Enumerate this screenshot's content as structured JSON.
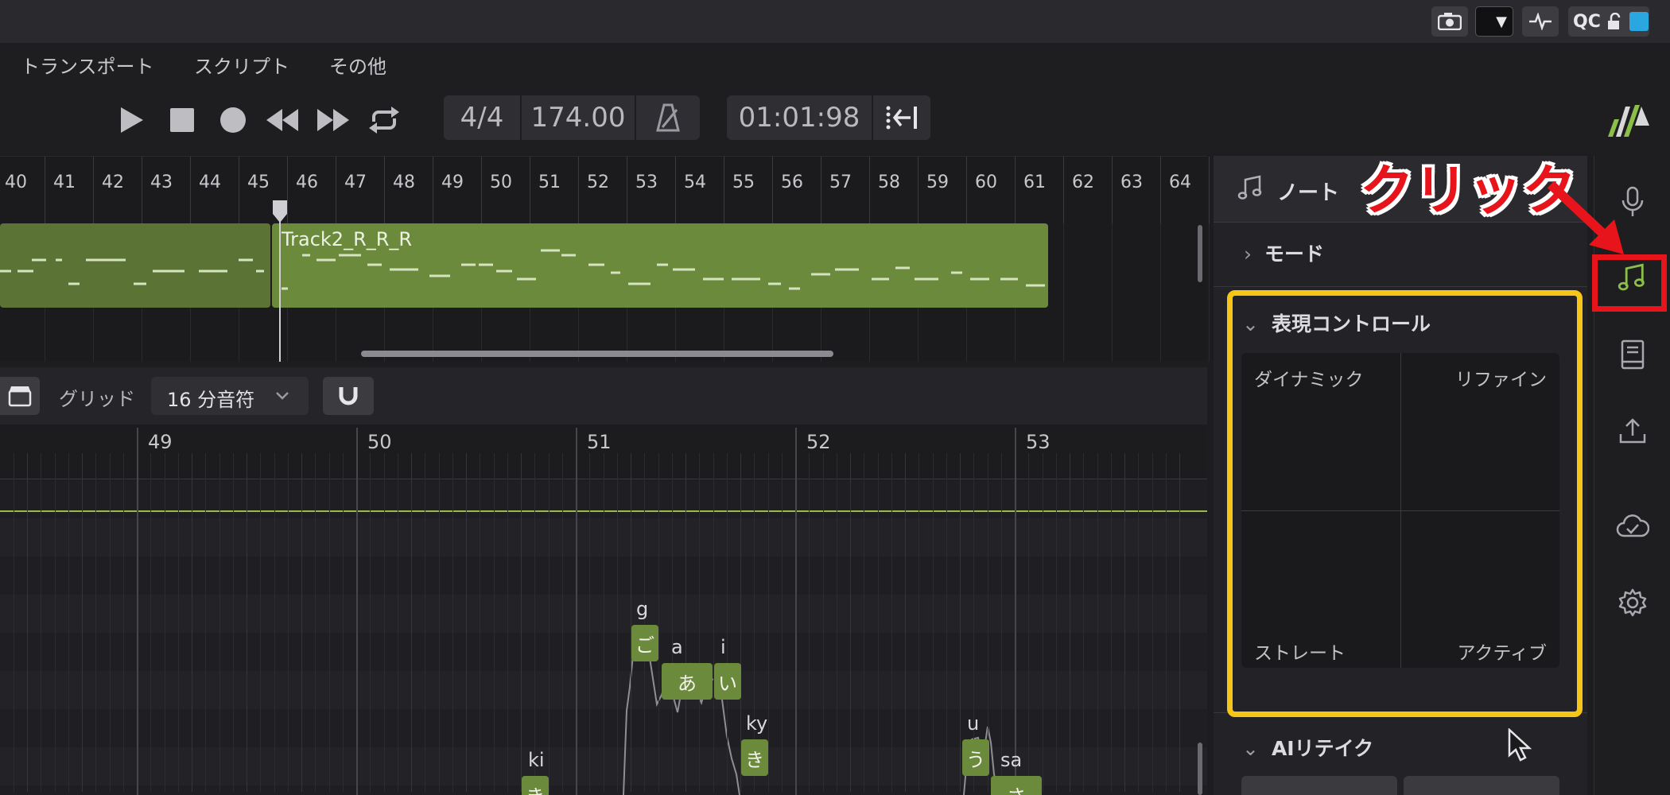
{
  "topbar": {
    "qc_label": "QC"
  },
  "menu": {
    "items": [
      "トランスポート",
      "スクリプト",
      "その他"
    ]
  },
  "transport": {
    "time_signature": "4/4",
    "tempo": "174.00",
    "time": "01:01:98"
  },
  "timeline": {
    "bar_numbers": [
      "40",
      "41",
      "42",
      "43",
      "44",
      "45",
      "46",
      "47",
      "48",
      "49",
      "50",
      "51",
      "52",
      "53",
      "54",
      "55",
      "56",
      "57",
      "58",
      "59",
      "60",
      "61",
      "62",
      "63",
      "64"
    ],
    "clip_name": "Track2_R_R_R"
  },
  "editor": {
    "grid_label": "グリッド",
    "grid_value": "16 分音符",
    "bar_numbers": [
      "49",
      "50",
      "51",
      "52",
      "53"
    ],
    "notes": [
      {
        "phoneme": "g",
        "lyric": "ご"
      },
      {
        "phoneme": "a",
        "lyric": "あ"
      },
      {
        "phoneme": "i",
        "lyric": "い"
      },
      {
        "phoneme": "ky",
        "lyric": "き"
      },
      {
        "phoneme": "ki",
        "lyric": "き"
      },
      {
        "phoneme": "u",
        "lyric": "う"
      },
      {
        "phoneme": "sa",
        "lyric": "さ"
      }
    ]
  },
  "panel": {
    "title": "ノート",
    "sections": {
      "mode": "モード",
      "expression": "表現コントロール",
      "ai_retake": "AIリテイク"
    },
    "pad_labels": {
      "top_left": "ダイナミック",
      "top_right": "リファイン",
      "bottom_left": "ストレート",
      "bottom_right": "アクティブ"
    }
  },
  "annotation": {
    "click_text": "クリック"
  },
  "icons": {
    "sidebar": [
      "microphone-icon",
      "music-note-icon",
      "book-icon",
      "upload-icon",
      "cloud-icon",
      "gear-icon"
    ],
    "accent_green": "#6c8a3c",
    "highlight_yellow": "#f5c518",
    "highlight_red": "#e8141c"
  }
}
